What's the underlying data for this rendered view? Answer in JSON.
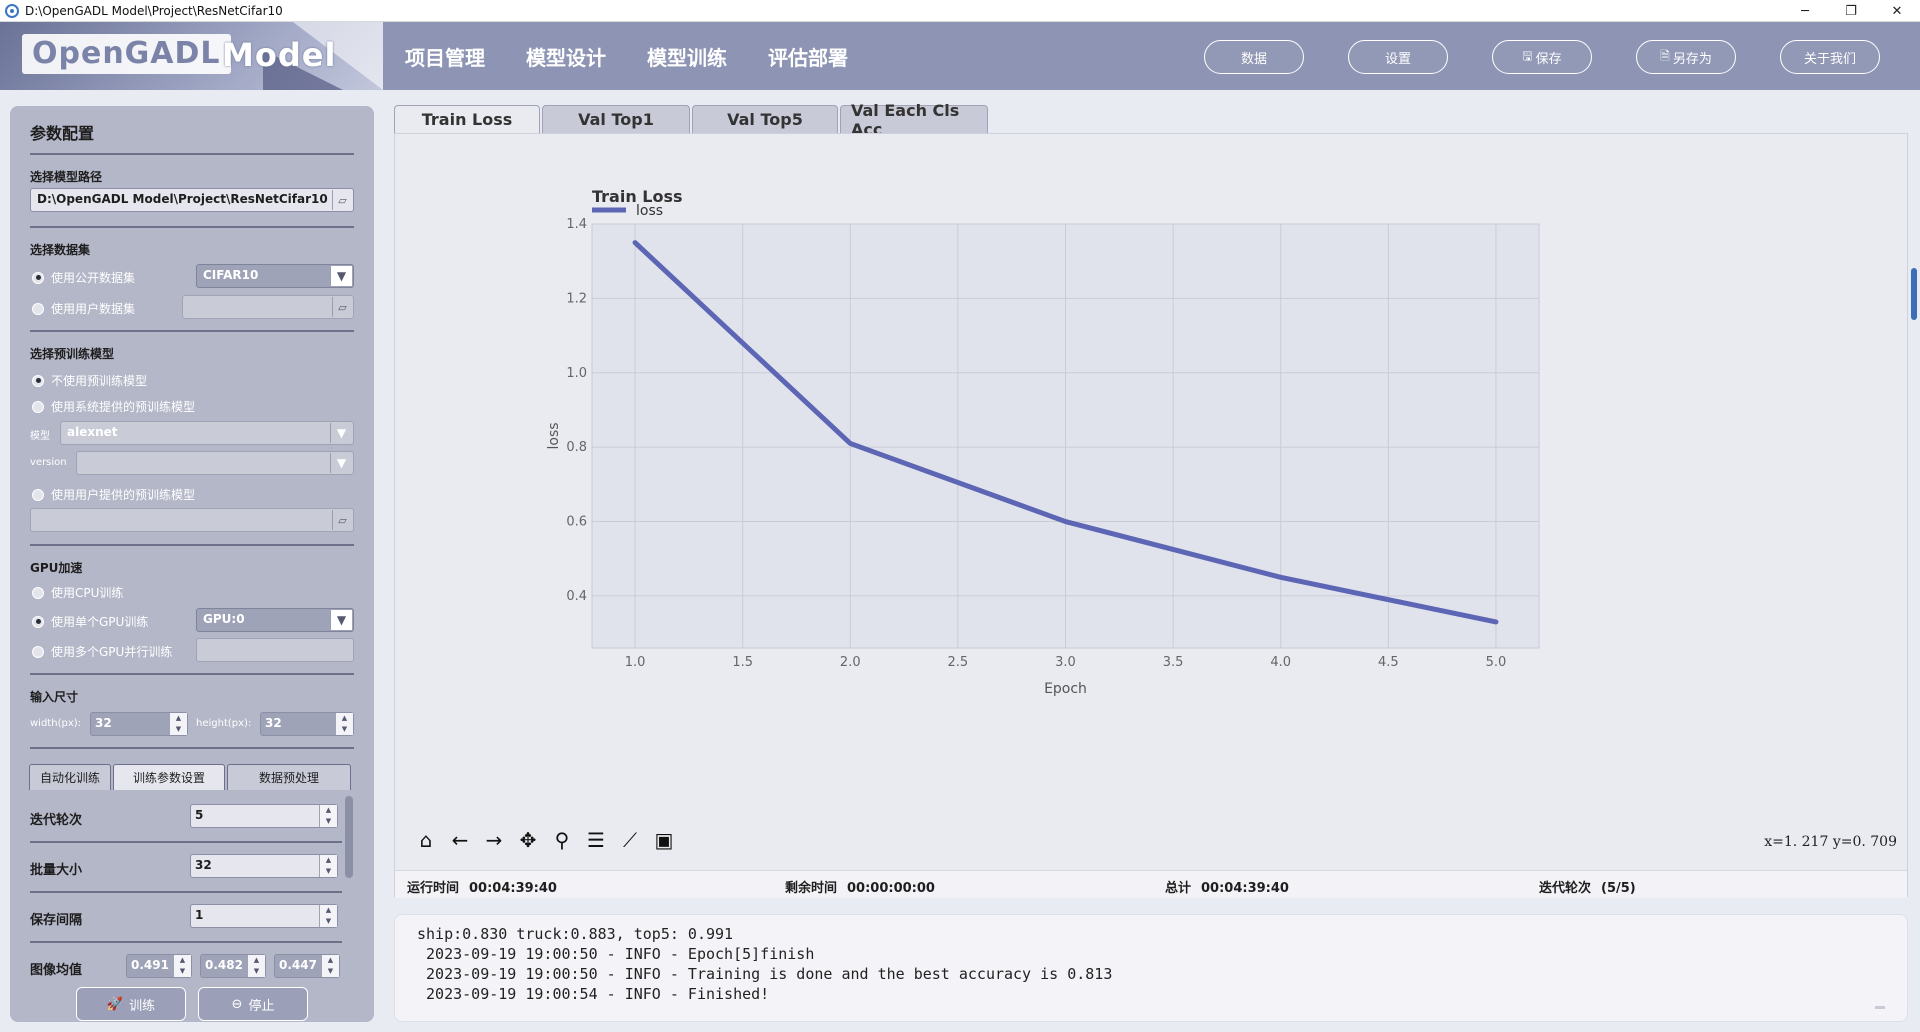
{
  "window": {
    "title": "D:\\OpenGADL Model\\Project\\ResNetCifar10",
    "controls": [
      "─",
      "❐",
      "✕"
    ]
  },
  "logo": {
    "word1": "OpenGADL",
    "word2": "Model"
  },
  "nav": [
    "项目管理",
    "模型设计",
    "模型训练",
    "评估部署"
  ],
  "top_buttons": [
    {
      "label": "数据",
      "icon": ""
    },
    {
      "label": "设置",
      "icon": ""
    },
    {
      "label": "保存",
      "icon": "🖫"
    },
    {
      "label": "另存为",
      "icon": "🗎"
    },
    {
      "label": "关于我们",
      "icon": ""
    }
  ],
  "sidebar": {
    "title": "参数配置",
    "model_path": {
      "label": "选择模型路径",
      "value": "D:\\OpenGADL Model\\Project\\ResNetCifar10"
    },
    "dataset": {
      "label": "选择数据集",
      "public": {
        "label": "使用公开数据集",
        "value": "CIFAR10",
        "checked": true
      },
      "user": {
        "label": "使用用户数据集",
        "value": ""
      }
    },
    "pretrain": {
      "label": "选择预训练模型",
      "none": "不使用预训练模型",
      "system": "使用系统提供的预训练模型",
      "model_label": "模型",
      "model_value": "alexnet",
      "version_label": "version",
      "version_value": "",
      "user": "使用用户提供的预训练模型",
      "user_path": ""
    },
    "gpu": {
      "label": "GPU加速",
      "cpu": "使用CPU训练",
      "single": "使用单个GPU训练",
      "single_value": "GPU:0",
      "multi": "使用多个GPU并行训练",
      "multi_value": ""
    },
    "input_size": {
      "label": "输入尺寸",
      "width_label": "width(px):",
      "width": "32",
      "height_label": "height(px):",
      "height": "32"
    },
    "subtabs": [
      "自动化训练",
      "训练参数设置",
      "数据预处理"
    ],
    "params": {
      "epochs_label": "迭代轮次",
      "epochs": "5",
      "batch_label": "批量大小",
      "batch": "32",
      "save_label": "保存间隔",
      "save": "1",
      "mean_label": "图像均值",
      "mean": [
        "0.491",
        "0.482",
        "0.447"
      ]
    },
    "train_button": "训练",
    "stop_button": "停止"
  },
  "plot_tabs": [
    "Train Loss",
    "Val Top1",
    "Val Top5",
    "Val Each Cls Acc"
  ],
  "chart_data": {
    "type": "line",
    "title": "Train Loss",
    "xlabel": "Epoch",
    "ylabel": "loss",
    "legend": "top-left",
    "grid": true,
    "xlim": [
      0.8,
      5.2
    ],
    "ylim": [
      0.26,
      1.4
    ],
    "x_ticks": [
      "1.0",
      "1.5",
      "2.0",
      "2.5",
      "3.0",
      "3.5",
      "4.0",
      "4.5",
      "5.0"
    ],
    "y_ticks": [
      "0.4",
      "0.6",
      "0.8",
      "1.0",
      "1.2",
      "1.4"
    ],
    "series": [
      {
        "name": "loss",
        "color": "#5c66b4",
        "x": [
          1,
          2,
          3,
          4,
          5
        ],
        "y": [
          1.35,
          0.81,
          0.6,
          0.45,
          0.33
        ]
      }
    ]
  },
  "toolbar_icons": [
    "home-icon",
    "back-icon",
    "forward-icon",
    "pan-icon",
    "zoom-icon",
    "configure-icon",
    "edit-curve-icon",
    "save-figure-icon"
  ],
  "coords": "x=1. 217  y=0. 709",
  "status": {
    "run_label": "运行时间",
    "run": "00:04:39:40",
    "remain_label": "剩余时间",
    "remain": "00:00:00:00",
    "total_label": "总计",
    "total": "00:04:39:40",
    "epoch_label": "迭代轮次",
    "epoch": "(5/5)"
  },
  "log": [
    "ship:0.830 truck:0.883, top5: 0.991",
    " 2023-09-19 19:00:50 - INFO - Epoch[5]finish",
    " 2023-09-19 19:00:50 - INFO - Training is done and the best accuracy is 0.813",
    " 2023-09-19 19:00:54 - INFO - Finished!"
  ]
}
